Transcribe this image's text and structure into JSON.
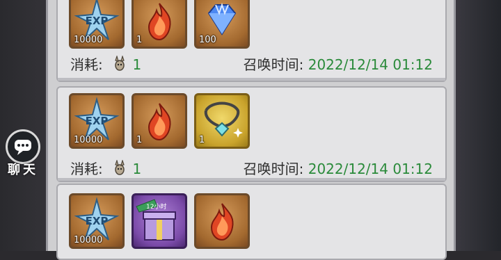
{
  "records": [
    {
      "items": [
        {
          "icon": "exp-star-icon",
          "qty": "10000"
        },
        {
          "icon": "flame-icon",
          "qty": "1"
        },
        {
          "icon": "diamond-icon",
          "qty": "100"
        }
      ],
      "cost_label": "消耗:",
      "cost_value": "1",
      "time_label": "召唤时间:",
      "time_value": "2022/12/14 01:12"
    },
    {
      "items": [
        {
          "icon": "exp-star-icon",
          "qty": "10000"
        },
        {
          "icon": "flame-icon",
          "qty": "1"
        },
        {
          "icon": "amulet-necklace-icon",
          "qty": "1"
        }
      ],
      "cost_label": "消耗:",
      "cost_value": "1",
      "time_label": "召唤时间:",
      "time_value": "2022/12/14 01:12"
    },
    {
      "items": [
        {
          "icon": "exp-star-icon",
          "qty": "10000"
        },
        {
          "icon": "exp-gift-box-icon",
          "qty": "",
          "badge": "12小时"
        },
        {
          "icon": "flame-icon",
          "qty": ""
        }
      ]
    }
  ],
  "chat": {
    "label": "聊天"
  },
  "colors": {
    "time_value": "#2a8a3a",
    "panel": "#cfcfd1"
  }
}
